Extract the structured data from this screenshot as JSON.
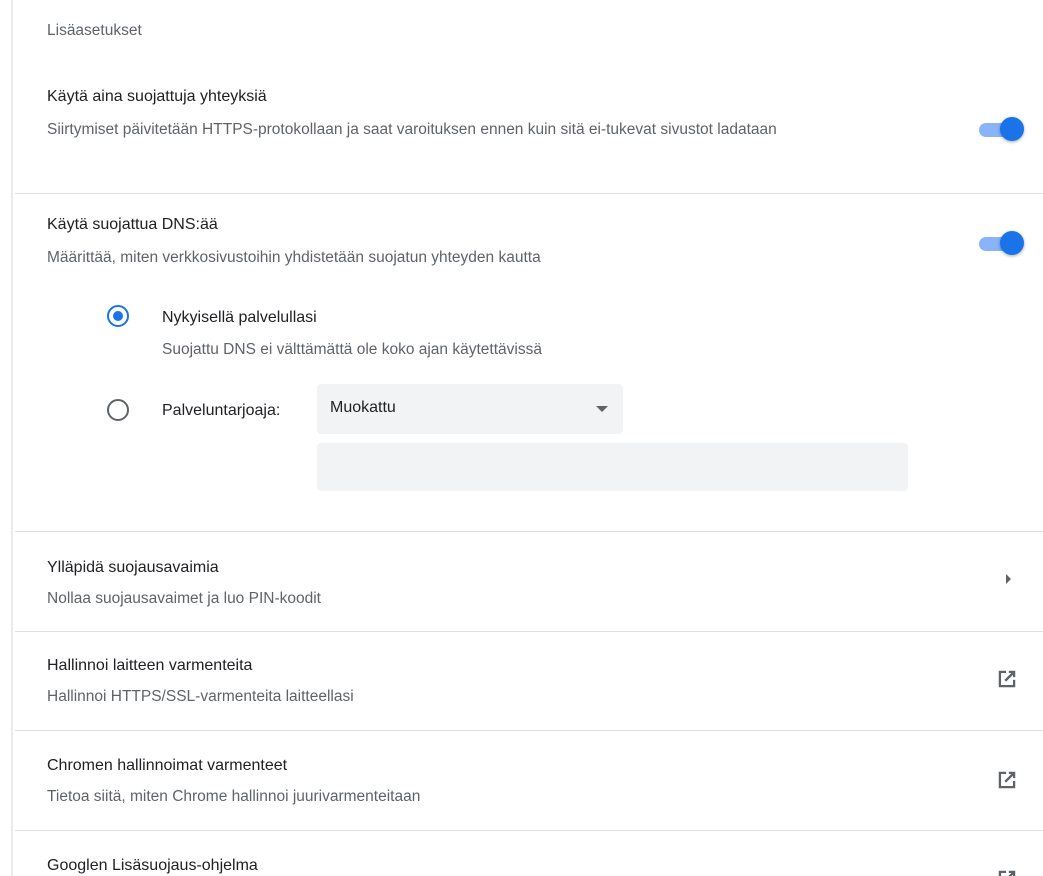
{
  "section_title": "Lisäasetukset",
  "https_setting": {
    "title": "Käytä aina suojattuja yhteyksiä",
    "description": "Siirtymiset päivitetään HTTPS-protokollaan ja saat varoituksen ennen kuin sitä ei-tukevat sivustot ladataan",
    "enabled": true
  },
  "dns_setting": {
    "title": "Käytä suojattua DNS:ää",
    "description": "Määrittää, miten verkkosivustoihin yhdistetään suojatun yhteyden kautta",
    "enabled": true,
    "option_current": {
      "label": "Nykyisellä palvelullasi",
      "description": "Suojattu DNS ei välttämättä ole koko ajan käytettävissä",
      "selected": true
    },
    "option_provider": {
      "label": "Palveluntarjoaja:",
      "selected": false,
      "select_value": "Muokattu",
      "custom_input_value": ""
    }
  },
  "security_keys": {
    "title": "Ylläpidä suojausavaimia",
    "description": "Nollaa suojausavaimet ja luo PIN-koodit"
  },
  "device_certs": {
    "title": "Hallinnoi laitteen varmenteita",
    "description": "Hallinnoi HTTPS/SSL-varmenteita laitteellasi"
  },
  "chrome_certs": {
    "title": "Chromen hallinnoimat varmenteet",
    "description": "Tietoa siitä, miten Chrome hallinnoi juurivarmenteitaan"
  },
  "advanced_protection": {
    "title": "Googlen Lisäsuojaus-ohjelma"
  },
  "colors": {
    "accent": "#1a73e8",
    "toggle_track": "#8ab4f8",
    "secondary_text": "#5f6368",
    "divider": "#e0e0e0"
  }
}
